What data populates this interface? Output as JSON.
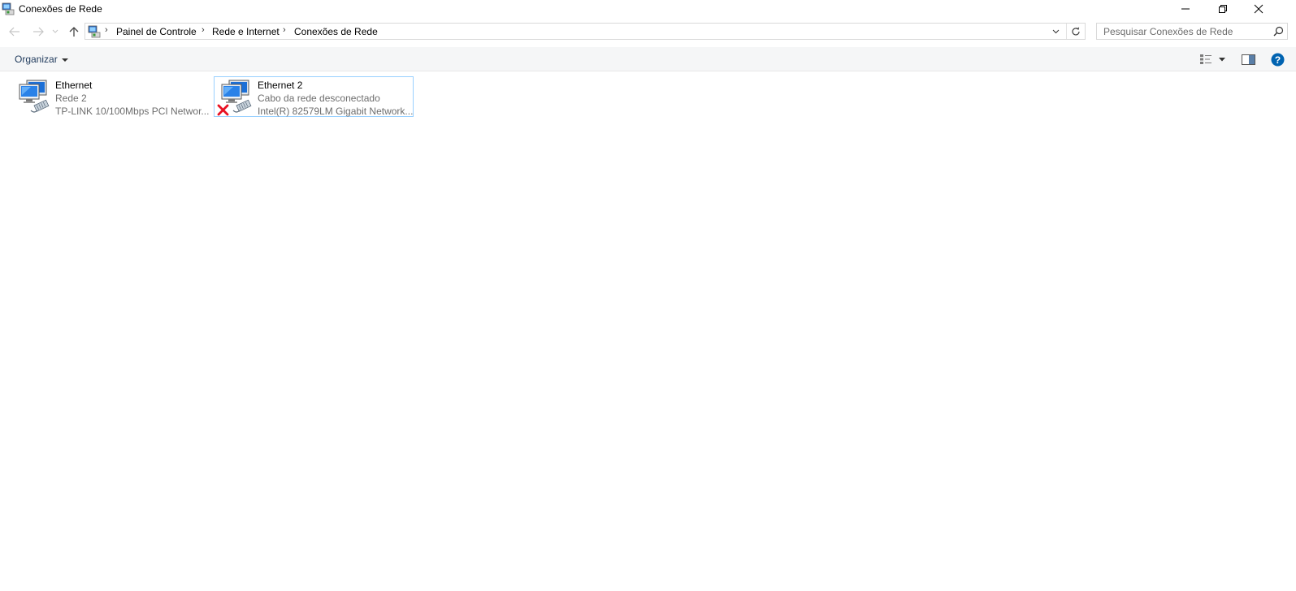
{
  "window": {
    "title": "Conexões de Rede"
  },
  "address_bar": {
    "breadcrumbs": [
      "Painel de Controle",
      "Rede e Internet",
      "Conexões de Rede"
    ]
  },
  "search": {
    "placeholder": "Pesquisar Conexões de Rede"
  },
  "command_bar": {
    "organize_label": "Organizar"
  },
  "connections": [
    {
      "name": "Ethernet",
      "status": "Rede  2",
      "adapter": "TP-LINK 10/100Mbps PCI Networ...",
      "disconnected": false,
      "selected": false
    },
    {
      "name": "Ethernet 2",
      "status": "Cabo da rede desconectado",
      "adapter": "Intel(R) 82579LM Gigabit Network...",
      "disconnected": true,
      "selected": true
    }
  ],
  "colors": {
    "selection_border": "#99d1ff",
    "command_bar_bg": "#f5f6f7",
    "secondary_text": "#6d6d6d",
    "help_blue": "#0063b1",
    "error_red": "#e81123"
  }
}
